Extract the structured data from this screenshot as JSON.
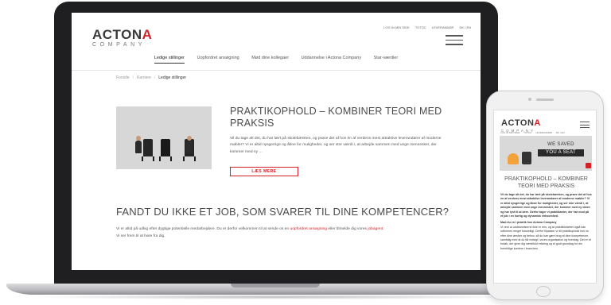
{
  "desktop": {
    "logo": {
      "main_left": "ACTON",
      "main_right": "A",
      "sub": "COMPANY"
    },
    "topnav": [
      "LOG IN MIN SIDE",
      "TOTOC",
      "LEVERANDØR",
      "DK / EN"
    ],
    "nav": [
      {
        "label": "Ledige stillinger",
        "active": true
      },
      {
        "label": "Uopfordret ansøgning"
      },
      {
        "label": "Mød dine kollegaer"
      },
      {
        "label": "Uddannelse i Actona Company"
      },
      {
        "label": "Star-værdier"
      }
    ],
    "breadcrumb": [
      "Forside",
      "Karriere",
      "Ledige stillinger"
    ],
    "feature": {
      "title": "PRAKTIKOPHOLD – KOMBINER TEORI MED PRAKSIS",
      "text": "Vil du tage alt det, du har lært på skolebænken, og prøve det af hos én af verdens mest attraktive leverandører af moderne møbler? Vi er altid nysgerrige og åbne for muligheder, og ser stor værdi i, at arbejde sammen med unge mennesker, der kommer med ny …",
      "button": "LÆS MERE"
    },
    "section": {
      "title": "FANDT DU IKKE ET JOB, SOM SVARER TIL DINE KOMPETENCER?",
      "line1_a": "Vi er altid på udkig efter dygtige potentielle medarbejdere. Du er derfor velkommen til at sende os en ",
      "line1_link1": "uopfordret ansøgning",
      "line1_b": " eller tilmelde dig vores ",
      "line1_link2": "jobagent",
      "line1_c": ".",
      "line2": "Vi ser frem til at høre fra dig."
    }
  },
  "mobile": {
    "logo": {
      "main_left": "ACTON",
      "main_right": "A",
      "sub": "COMPANY"
    },
    "topnav": [
      "LOG IN MIN SIDE",
      "TOTOC",
      "LEVERANDØR",
      "DK / EN"
    ],
    "banner": {
      "line1": "WE SAVED",
      "line2": "YOU A SEAT"
    },
    "title": "PRAKTIKOPHOLD – KOMBINER TEORI MED PRAKSIS",
    "intro": "Vil du tage alt det, du har lært på skolebænken, og prøve det af hos én af verdens mest attraktive leverandører af moderne møbler? Vi er altid nysgerrige og åbne for muligheder, og ser stor værdi i, at arbejde sammen med unge mennesker, der kommer med ny viden og har lyst til at lære. Derfor tager vi praktikanter, der har mod på et job i en hurtig og dynamisk virksomhed.",
    "subheading": "Mød du en i praktik hos Actona Company",
    "body": "Vi vest at uddannelserne ikke er ens, og at praktikforløbet også kan udformes meget forskelligt. Derfor tilpasser vi dit praktikophold hos os efter dine ønsker og behov, så du kan gøre brug af dine kompetencer, samtidig med at du får indsigt i vores organisation og hverdag. Det er et forløb, der giver dig værdifuld erfaring og et godt grundlag for din fremtidige karriere i branchen."
  },
  "colors": {
    "brand_red": "#d32026",
    "laptop_frame": "#1f1f21",
    "text": "#4a4a4a"
  }
}
